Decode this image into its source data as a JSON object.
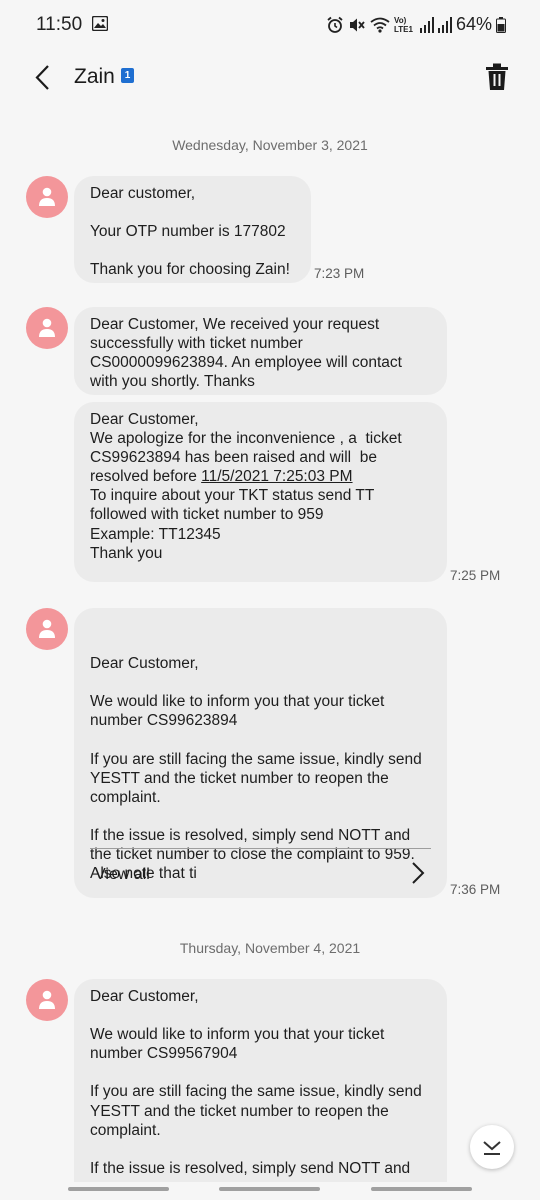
{
  "status_bar": {
    "time": "11:50",
    "battery": "64%",
    "network_label": "Vo) LTE1"
  },
  "header": {
    "contact_name": "Zain",
    "sim_badge": "1"
  },
  "dates": {
    "first": "Wednesday, November 3, 2021",
    "second": "Thursday, November 4, 2021"
  },
  "messages": [
    {
      "text": "Dear customer,\n\nYour OTP number is 177802\n\nThank you for choosing Zain!",
      "time": "7:23 PM"
    },
    {
      "text": "Dear Customer, We received your request successfully with ticket number CS0000099623894. An employee will contact with you shortly. Thanks",
      "time": ""
    },
    {
      "text_before": "Dear Customer,\nWe apologize for the inconvenience , a  ticket CS99623894 has been raised and will  be resolved before ",
      "link": "11/5/2021 7:25:03 PM",
      "text_after": "\nTo inquire about your TKT status send TT followed with ticket number to 959\nExample: TT12345\nThank you",
      "time": "7:25 PM"
    },
    {
      "text": "Dear Customer,\n\nWe would like to inform you that your ticket number CS99623894\n\nIf you are still facing the same issue, kindly send YESTT and the ticket number to reopen the complaint.\n\nIf the issue is resolved, simply send NOTT and the ticket number to close the complaint to 959. Also note that ti",
      "view_all": "View all",
      "time": "7:36 PM"
    },
    {
      "text": "Dear Customer,\n\nWe would like to inform you that your ticket number CS99567904\n\nIf you are still facing the same issue, kindly send YESTT and the ticket number to reopen the complaint.\n\nIf the issue is resolved, simply send NOTT and",
      "time": ""
    }
  ],
  "colors": {
    "background": "#f6f6f6",
    "bubble": "#ebebeb",
    "avatar": "#f3969a",
    "sim_badge": "#1f6fd1"
  },
  "icons": [
    "back-arrow-icon",
    "trash-icon",
    "person-icon",
    "chevron-right-icon",
    "chevron-down-icon",
    "gallery-icon",
    "alarm-icon",
    "mute-icon",
    "wifi-icon",
    "signal-icon",
    "battery-icon"
  ]
}
